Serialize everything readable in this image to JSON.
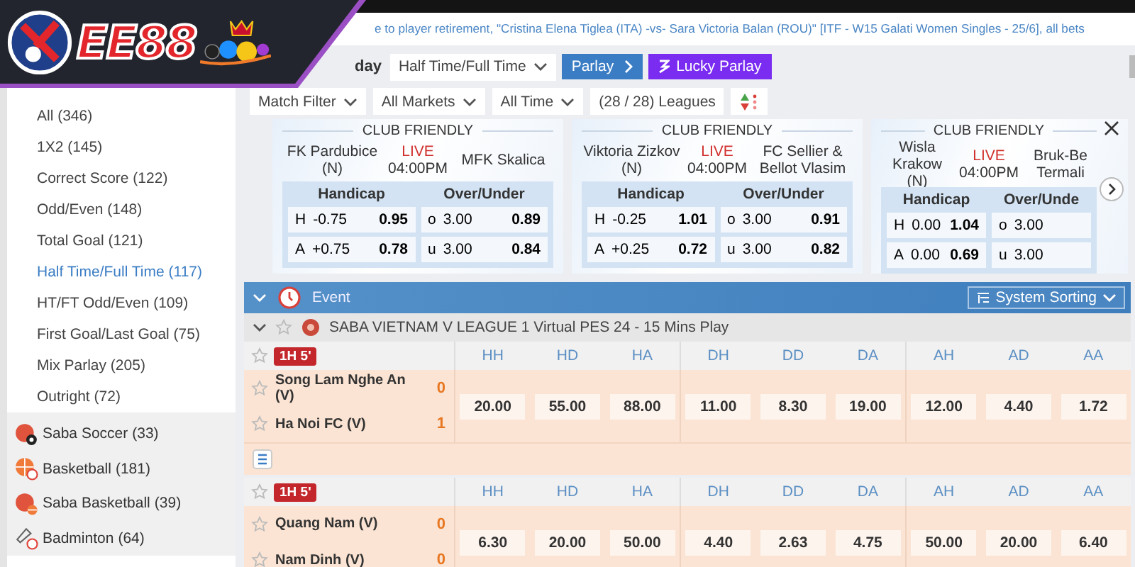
{
  "logo": {
    "text": "EE88"
  },
  "ticker": "e to player retirement, \"Cristina Elena Tiglea (ITA) -vs- Sara Victoria Balan (ROU)\" [ITF - W15 Galati Women Singles - 25/6], all bets",
  "toolbar": {
    "date_tab": "day",
    "market_dropdown": "Half Time/Full Time",
    "parlay_button": "Parlay",
    "lucky_parlay_button": "Lucky Parlay"
  },
  "filters": {
    "match_filter": "Match Filter",
    "markets": "All Markets",
    "time": "All Time",
    "leagues": "(28 / 28) Leagues"
  },
  "sidebar": {
    "markets": [
      {
        "label": "All (346)",
        "selected": false
      },
      {
        "label": "1X2 (145)",
        "selected": false
      },
      {
        "label": "Correct Score (122)",
        "selected": false
      },
      {
        "label": "Odd/Even (148)",
        "selected": false
      },
      {
        "label": "Total Goal (121)",
        "selected": false
      },
      {
        "label": "Half Time/Full Time (117)",
        "selected": true
      },
      {
        "label": "HT/FT Odd/Even (109)",
        "selected": false
      },
      {
        "label": "First Goal/Last Goal (75)",
        "selected": false
      },
      {
        "label": "Mix Parlay (205)",
        "selected": false
      },
      {
        "label": "Outright (72)",
        "selected": false
      }
    ],
    "sports": [
      {
        "kind": "saba-soccer",
        "label": "Saba Soccer",
        "count": "(33)"
      },
      {
        "kind": "basketball",
        "label": "Basketball",
        "count": "(181)"
      },
      {
        "kind": "saba-basketball",
        "label": "Saba Basketball",
        "count": "(39)"
      },
      {
        "kind": "badminton",
        "label": "Badminton",
        "count": "(64)"
      }
    ]
  },
  "featured": [
    {
      "league": "CLUB FRIENDLY",
      "home": "FK Pardubice (N)",
      "away": "MFK Skalica",
      "status": "LIVE",
      "time": "04:00PM",
      "handicap_header": "Handicap",
      "ou_header": "Over/Under",
      "handicap": [
        {
          "side": "H",
          "line": "-0.75",
          "price": "0.95"
        },
        {
          "side": "A",
          "line": "+0.75",
          "price": "0.78"
        }
      ],
      "over_under": [
        {
          "side": "o",
          "line": "3.00",
          "price": "0.89"
        },
        {
          "side": "u",
          "line": "3.00",
          "price": "0.84"
        }
      ]
    },
    {
      "league": "CLUB FRIENDLY",
      "home": "Viktoria Zizkov (N)",
      "away": "FC Sellier & Bellot Vlasim",
      "status": "LIVE",
      "time": "04:00PM",
      "handicap_header": "Handicap",
      "ou_header": "Over/Under",
      "handicap": [
        {
          "side": "H",
          "line": "-0.25",
          "price": "1.01"
        },
        {
          "side": "A",
          "line": "+0.25",
          "price": "0.72"
        }
      ],
      "over_under": [
        {
          "side": "o",
          "line": "3.00",
          "price": "0.91"
        },
        {
          "side": "u",
          "line": "3.00",
          "price": "0.82"
        }
      ]
    },
    {
      "league": "CLUB FRIENDLY",
      "home": "Wisla Krakow (N)",
      "away": "Bruk-Be Termali",
      "status": "LIVE",
      "time": "04:00PM",
      "handicap_header": "Handicap",
      "ou_header": "Over/Unde",
      "handicap": [
        {
          "side": "H",
          "line": "0.00",
          "price": "1.04"
        },
        {
          "side": "A",
          "line": "0.00",
          "price": "0.69"
        }
      ],
      "over_under": [
        {
          "side": "o",
          "line": "3.00"
        },
        {
          "side": "u",
          "line": "3.00"
        }
      ]
    }
  ],
  "event_table": {
    "title": "Event",
    "sorting": "System Sorting",
    "league": "SABA VIETNAM V LEAGUE 1 Virtual PES 24 - 15 Mins Play",
    "matches": [
      {
        "period": "1H 5'",
        "columns": [
          "HH",
          "HD",
          "HA",
          "DH",
          "DD",
          "DA",
          "AH",
          "AD",
          "AA"
        ],
        "home": "Song Lam Nghe An (V)",
        "home_score": "0",
        "away": "Ha Noi FC (V)",
        "away_score": "1",
        "odds": [
          "20.00",
          "55.00",
          "88.00",
          "11.00",
          "8.30",
          "19.00",
          "12.00",
          "4.40",
          "1.72"
        ]
      },
      {
        "period": "1H 5'",
        "columns": [
          "HH",
          "HD",
          "HA",
          "DH",
          "DD",
          "DA",
          "AH",
          "AD",
          "AA"
        ],
        "home": "Quang Nam (V)",
        "home_score": "0",
        "away": "Nam Dinh (V)",
        "away_score": "0",
        "odds": [
          "6.30",
          "20.00",
          "50.00",
          "4.40",
          "2.63",
          "4.75",
          "50.00",
          "20.00",
          "6.40"
        ]
      }
    ]
  }
}
